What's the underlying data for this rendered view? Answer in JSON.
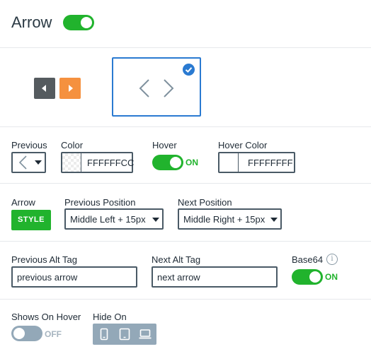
{
  "header": {
    "title": "Arrow",
    "enabled": true
  },
  "style_picker": {
    "colors": {
      "prev_button": "#555b5f",
      "next_button": "#f5913f",
      "selected_border": "#2a7ad1",
      "arrow_stroke": "#7f919e"
    },
    "selected": true
  },
  "colors_row": {
    "previous_label": "Previous",
    "color_label": "Color",
    "color_value": "FFFFFFCC",
    "hover_label": "Hover",
    "hover_state": "ON",
    "hover_color_label": "Hover Color",
    "hover_color_value": "FFFFFFFF"
  },
  "arrow_row": {
    "arrow_label": "Arrow",
    "style_button": "STYLE",
    "previous_position_label": "Previous Position",
    "previous_position_value": "Middle Left + 15px",
    "next_position_label": "Next Position",
    "next_position_value": "Middle Right + 15px"
  },
  "alt_row": {
    "previous_alt_label": "Previous Alt Tag",
    "previous_alt_value": "previous arrow",
    "next_alt_label": "Next Alt Tag",
    "next_alt_value": "next arrow",
    "base64_label": "Base64",
    "info_glyph": "i",
    "base64_state": "ON"
  },
  "visibility_row": {
    "shows_on_hover_label": "Shows On Hover",
    "shows_on_hover_state": "OFF",
    "hide_on_label": "Hide On",
    "devices": [
      "phone-icon",
      "tablet-icon",
      "laptop-icon"
    ]
  },
  "colors": {
    "accent_green": "#21b32d",
    "accent_blue": "#2a7ad1",
    "toggle_off": "#93a8b8"
  }
}
